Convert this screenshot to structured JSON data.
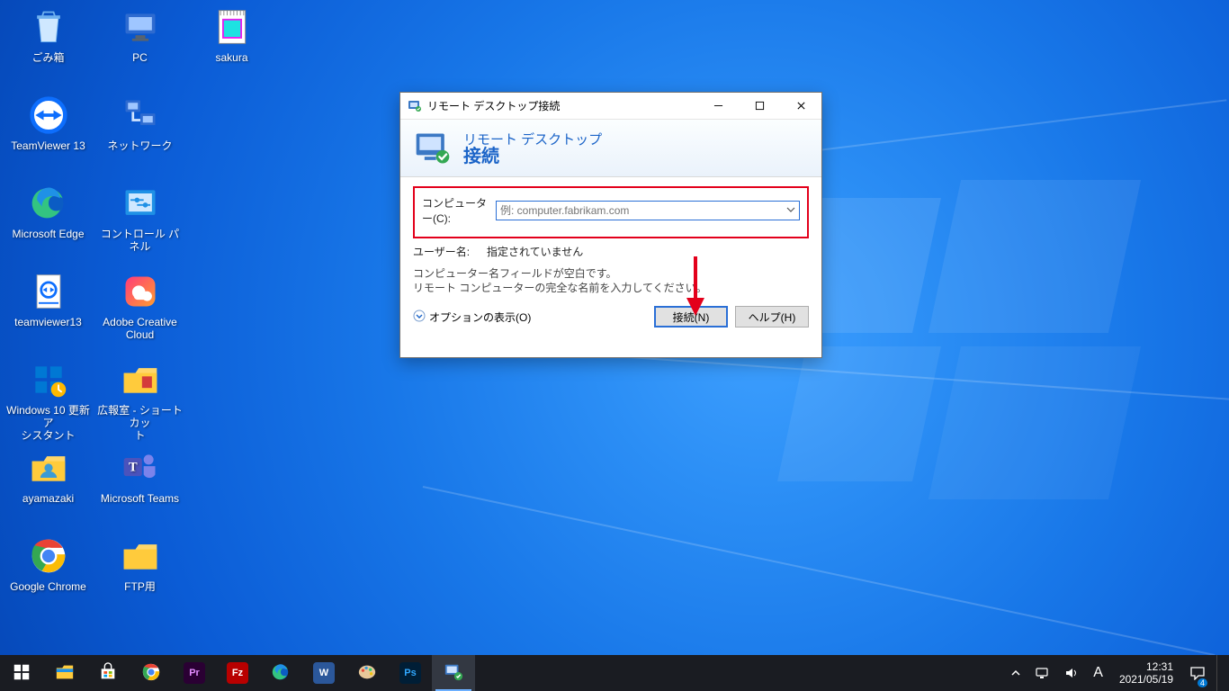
{
  "desktop": {
    "icons": [
      {
        "id": "recycle-bin",
        "label": "ごみ箱",
        "col": 0,
        "row": 0
      },
      {
        "id": "pc",
        "label": "PC",
        "col": 1,
        "row": 0
      },
      {
        "id": "sakura",
        "label": "sakura",
        "col": 2,
        "row": 0
      },
      {
        "id": "teamviewer13app",
        "label": "TeamViewer 13",
        "col": 0,
        "row": 1
      },
      {
        "id": "network",
        "label": "ネットワーク",
        "col": 1,
        "row": 1
      },
      {
        "id": "edge",
        "label": "Microsoft Edge",
        "col": 0,
        "row": 2
      },
      {
        "id": "control-panel",
        "label": "コントロール パネル",
        "col": 1,
        "row": 2
      },
      {
        "id": "teamviewer13file",
        "label": "teamviewer13",
        "col": 0,
        "row": 3
      },
      {
        "id": "adobe-cc",
        "label": "Adobe Creative\nCloud",
        "col": 1,
        "row": 3
      },
      {
        "id": "win-update-asst",
        "label": "Windows 10 更新ア\nシスタント",
        "col": 0,
        "row": 4
      },
      {
        "id": "kouhoushitsu",
        "label": "広報室 - ショートカッ\nト",
        "col": 1,
        "row": 4
      },
      {
        "id": "ayamazaki",
        "label": "ayamazaki",
        "col": 0,
        "row": 5
      },
      {
        "id": "ms-teams",
        "label": "Microsoft Teams",
        "col": 1,
        "row": 5
      },
      {
        "id": "chrome",
        "label": "Google Chrome",
        "col": 0,
        "row": 6
      },
      {
        "id": "ftp-folder",
        "label": "FTP用",
        "col": 1,
        "row": 6
      }
    ]
  },
  "dialog": {
    "title": "リモート デスクトップ接続",
    "banner_top": "リモート デスクトップ",
    "banner_main": "接続",
    "computer_label": "コンピューター(C):",
    "computer_placeholder": "例: computer.fabrikam.com",
    "user_label": "ユーザー名:",
    "user_value": "指定されていません",
    "hint1": "コンピューター名フィールドが空白です。",
    "hint2": "リモート コンピューターの完全な名前を入力してください。",
    "options_label": "オプションの表示(O)",
    "connect_label": "接続(N)",
    "help_label": "ヘルプ(H)"
  },
  "taskbar": {
    "buttons": [
      {
        "id": "start",
        "name": "start-button"
      },
      {
        "id": "explorer",
        "name": "file-explorer"
      },
      {
        "id": "store",
        "name": "microsoft-store"
      },
      {
        "id": "chrome",
        "name": "chrome"
      },
      {
        "id": "premiere",
        "name": "premiere-pro",
        "badge": "Pr",
        "bg": "#2a0033",
        "fg": "#e38cff"
      },
      {
        "id": "filezilla",
        "name": "filezilla",
        "badge": "Fz",
        "bg": "#b80000",
        "fg": "#fff"
      },
      {
        "id": "edge",
        "name": "edge"
      },
      {
        "id": "word",
        "name": "word",
        "badge": "W",
        "bg": "#2b579a",
        "fg": "#fff"
      },
      {
        "id": "paint",
        "name": "paint"
      },
      {
        "id": "photoshop",
        "name": "photoshop",
        "badge": "Ps",
        "bg": "#001e36",
        "fg": "#31a8ff"
      },
      {
        "id": "mstsc",
        "name": "remote-desktop",
        "active": true
      }
    ]
  },
  "tray": {
    "ime": "A",
    "time": "12:31",
    "date": "2021/05/19",
    "notif_badge": "4"
  }
}
